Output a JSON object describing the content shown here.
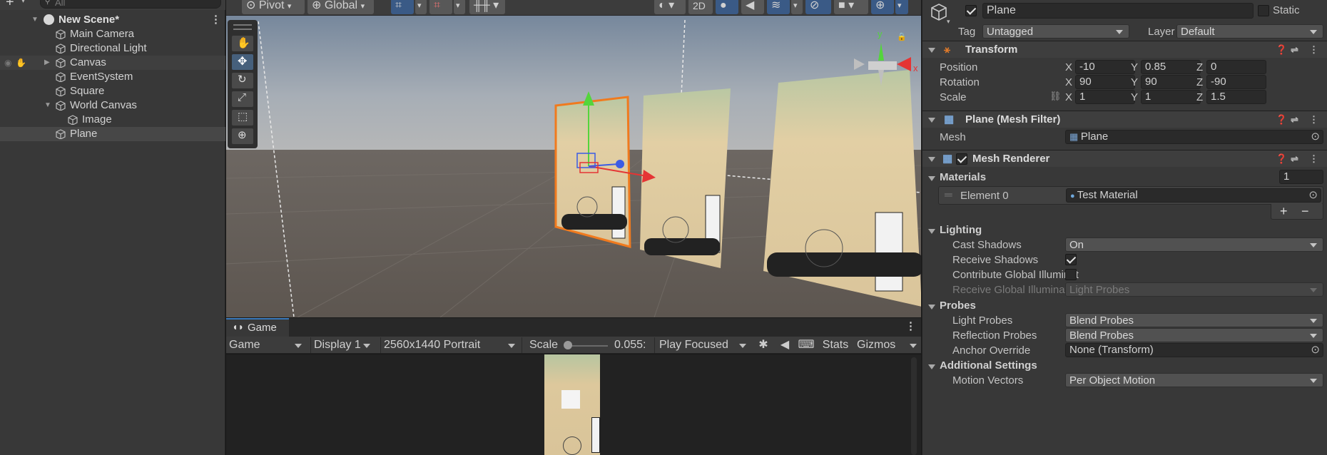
{
  "hierarchy": {
    "search_placeholder": "All",
    "scene_name": "New Scene*",
    "items": [
      {
        "label": "Main Camera"
      },
      {
        "label": "Directional Light"
      },
      {
        "label": "Canvas"
      },
      {
        "label": "EventSystem"
      },
      {
        "label": "Square"
      },
      {
        "label": "World Canvas"
      },
      {
        "label": "Image"
      },
      {
        "label": "Plane"
      }
    ]
  },
  "scene_toolbar": {
    "pivot": "Pivot",
    "global": "Global",
    "mode_2d": "2D"
  },
  "game": {
    "tab_label": "Game",
    "view_mode": "Game",
    "display": "Display 1",
    "resolution": "2560x1440 Portrait",
    "scale_label": "Scale",
    "scale_value": "0.055:",
    "play_mode": "Play Focused",
    "stats": "Stats",
    "gizmos": "Gizmos"
  },
  "inspector": {
    "object_name": "Plane",
    "static_label": "Static",
    "tag_label": "Tag",
    "tag_value": "Untagged",
    "layer_label": "Layer",
    "layer_value": "Default",
    "transform": {
      "title": "Transform",
      "position_label": "Position",
      "rotation_label": "Rotation",
      "scale_label": "Scale",
      "axis_x": "X",
      "axis_y": "Y",
      "axis_z": "Z",
      "position": {
        "x": "-10",
        "y": "0.85",
        "z": "0"
      },
      "rotation": {
        "x": "90",
        "y": "90",
        "z": "-90"
      },
      "scale": {
        "x": "1",
        "y": "1",
        "z": "1.5"
      }
    },
    "mesh_filter": {
      "title": "Plane (Mesh Filter)",
      "mesh_label": "Mesh",
      "mesh_value": "Plane"
    },
    "mesh_renderer": {
      "title": "Mesh Renderer",
      "materials_label": "Materials",
      "materials_count": "1",
      "element0_label": "Element 0",
      "element0_value": "Test Material",
      "add": "+",
      "remove": "−",
      "lighting_label": "Lighting",
      "cast_shadows_label": "Cast Shadows",
      "cast_shadows_value": "On",
      "receive_shadows_label": "Receive Shadows",
      "contribute_gi_label": "Contribute Global Illuminat",
      "receive_gi_label": "Receive Global Illuminatio",
      "receive_gi_value": "Light Probes",
      "probes_label": "Probes",
      "light_probes_label": "Light Probes",
      "light_probes_value": "Blend Probes",
      "reflection_probes_label": "Reflection Probes",
      "reflection_probes_value": "Blend Probes",
      "anchor_override_label": "Anchor Override",
      "anchor_override_value": "None (Transform)",
      "additional_label": "Additional Settings",
      "motion_vectors_label": "Motion Vectors",
      "motion_vectors_value": "Per Object Motion"
    }
  },
  "colors": {
    "selection_orange": "#f07a1e",
    "active_tool_blue": "#46607c",
    "panel_bg": "#383838"
  }
}
